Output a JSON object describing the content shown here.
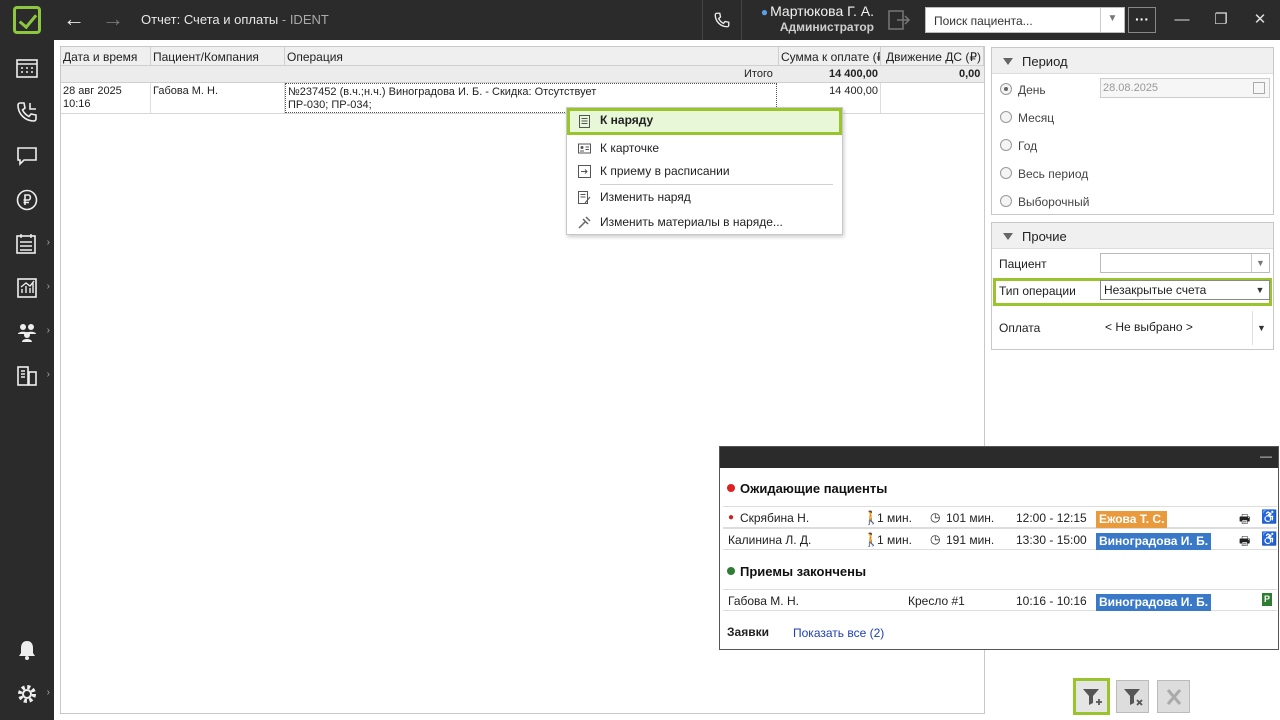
{
  "header": {
    "title": "Отчет: Счета и оплаты",
    "title_suffix": "- IDENT",
    "user_name": "Мартюкова Г. А.",
    "user_role": "Администратор",
    "search_placeholder": "Поиск пациента...",
    "more_label": "···"
  },
  "sidebar": {
    "items": [
      {
        "icon": "calendar-grid-icon"
      },
      {
        "icon": "phone-icon"
      },
      {
        "icon": "chat-icon"
      },
      {
        "icon": "ruble-icon"
      },
      {
        "icon": "schedule-icon"
      },
      {
        "icon": "reports-icon"
      },
      {
        "icon": "people-icon"
      },
      {
        "icon": "devices-icon"
      },
      {
        "icon": "bell-icon"
      },
      {
        "icon": "gear-icon"
      }
    ]
  },
  "grid": {
    "columns": [
      "Дата и время",
      "Пациент/Компания",
      "Операция",
      "Сумма к оплате (₽)",
      "Движение ДС (₽)"
    ],
    "total_label": "Итого",
    "total_sum": "14 400,00",
    "total_cash": "0,00",
    "rows": [
      {
        "date": "28 авг 2025",
        "time": "10:16",
        "patient": "Габова М. Н.",
        "operation_line1": "№237452 (в.ч.;н.ч.) Виноградова И. Б. - Скидка: Отсутствует",
        "operation_line2": "ПР-030; ПР-034;",
        "sum": "14 400,00",
        "cash": ""
      }
    ]
  },
  "context_menu": {
    "items": [
      {
        "label": "К наряду",
        "icon": "document-icon"
      },
      {
        "label": "К карточке",
        "icon": "card-icon"
      },
      {
        "label": "К приему в расписании",
        "icon": "schedule-link-icon"
      },
      {
        "label": "Изменить наряд",
        "icon": "edit-document-icon"
      },
      {
        "label": "Изменить материалы в наряде...",
        "icon": "tools-icon"
      }
    ]
  },
  "period_panel": {
    "title": "Период",
    "options": [
      "День",
      "Месяц",
      "Год",
      "Весь период",
      "Выборочный"
    ],
    "selected": "День",
    "date_value": "28.08.2025"
  },
  "other_panel": {
    "title": "Прочие",
    "patient_label": "Пациент",
    "patient_value": "",
    "op_type_label": "Тип операции",
    "op_type_value": "Незакрытые счета",
    "payment_label": "Оплата",
    "payment_value": "< Не выбрано >"
  },
  "notifications": {
    "waiting_title": "Ожидающие пациенты",
    "waiting": [
      {
        "name": "Скрябина Н.",
        "wait": "1 мин.",
        "elapsed": "101 мин.",
        "time": "12:00 - 12:15",
        "doctor": "Ежова Т. С.",
        "doctor_color": "#e89a3c"
      },
      {
        "name": "Калинина Л. Д.",
        "wait": "1 мин.",
        "elapsed": "191 мин.",
        "time": "13:30 - 15:00",
        "doctor": "Виноградова И. Б.",
        "doctor_color": "#3a78c8"
      }
    ],
    "finished_title": "Приемы закончены",
    "finished": [
      {
        "name": "Габова М. Н.",
        "chair": "Кресло #1",
        "time": "10:16 - 10:16",
        "doctor": "Виноградова И. Б."
      }
    ],
    "requests_label": "Заявки",
    "show_all_label": "Показать все (2)"
  },
  "colors": {
    "accent": "#9ac42c",
    "dark": "#2b2b2b",
    "waiting_dot": "#e02020",
    "finished_dot": "#2e7d32"
  }
}
